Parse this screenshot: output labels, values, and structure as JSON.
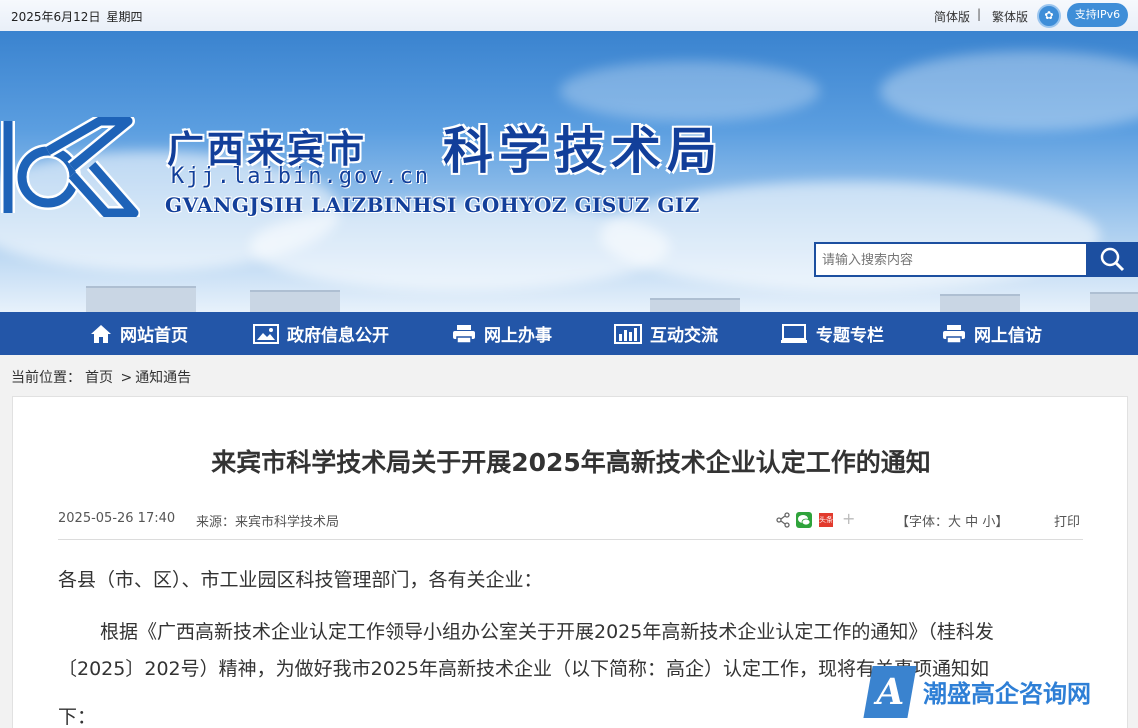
{
  "topbar": {
    "date": "2025年6月12日",
    "weekday": "星期四",
    "simplified": "简体版",
    "separator": "|",
    "traditional": "繁体版",
    "care_icon": "accessibility-icon",
    "ipv6": "支持IPv6"
  },
  "header": {
    "site_name_cn": "广西来宾市",
    "bureau_name": "科学技术局",
    "url": "Kjj.laibin.gov.cn",
    "zhuang_name": "GVANGJSIH LAIZBINHSI GOHYOZ GISUZ GIZ",
    "search_placeholder": "请输入搜索内容",
    "logo_icon": "laibin-kjj-logo",
    "search_icon": "magnifier-icon"
  },
  "nav": {
    "items": [
      {
        "label": "网站首页",
        "icon": "home-icon"
      },
      {
        "label": "政府信息公开",
        "icon": "picture-icon"
      },
      {
        "label": "网上办事",
        "icon": "printer-icon"
      },
      {
        "label": "互动交流",
        "icon": "bar-chart-icon"
      },
      {
        "label": "专题专栏",
        "icon": "monitor-icon"
      },
      {
        "label": "网上信访",
        "icon": "printer-icon"
      }
    ]
  },
  "breadcrumb": {
    "prefix": "当前位置：",
    "home": "首页",
    "sep": ">",
    "current": "通知通告"
  },
  "article": {
    "title": "来宾市科学技术局关于开展2025年高新技术企业认定工作的通知",
    "datetime": "2025-05-26 17:40",
    "source": "来源：来宾市科学技术局",
    "font_label_open": "【字体：",
    "font_big": "大",
    "font_mid": "中",
    "font_small": "小",
    "font_label_close": "】",
    "print": "打印",
    "toutiao": "头条",
    "more": "+",
    "p1": "各县（市、区）、市工业园区科技管理部门，各有关企业：",
    "p2_line1": "根据《广西高新技术企业认定工作领导小组办公室关于开展2025年高新技术企业认定工作的通知》（桂科发",
    "p2_line2": "〔2025〕202号）精神，为做好我市2025年高新技术企业（以下简称：高企）认定工作，现将有关事项通知如",
    "p2_line3": "下："
  },
  "watermark": {
    "letter": "A",
    "text": "潮盛高企咨询网"
  },
  "colors": {
    "nav_bg": "#2356a8",
    "brand_blue": "#123f9a",
    "accent": "#3f8ed8"
  }
}
